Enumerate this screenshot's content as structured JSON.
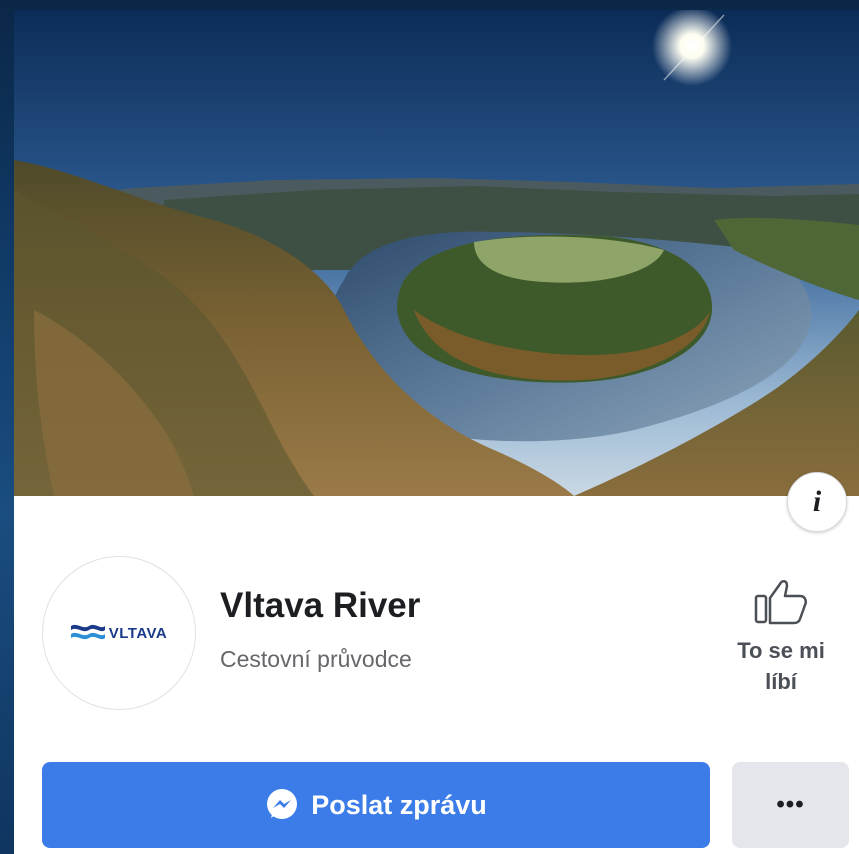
{
  "page": {
    "name": "Vltava River",
    "category": "Cestovní průvodce",
    "logo_text": "VLTAVA"
  },
  "actions": {
    "like_label_line1": "To se mi",
    "like_label_line2": "líbí",
    "message_label": "Poslat zprávu",
    "more_label": "•••",
    "info_label": "i"
  },
  "colors": {
    "primary_button": "#3c7ce8",
    "secondary_button": "#e4e6eb",
    "logo": "#1a3a8a"
  },
  "icons": {
    "info": "info-icon",
    "like": "thumbs-up-icon",
    "messenger": "messenger-icon"
  }
}
